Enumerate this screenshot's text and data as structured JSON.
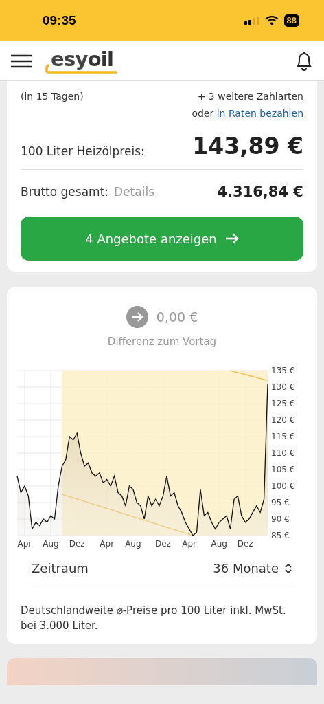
{
  "status_bar": {
    "time": "09:35",
    "battery": "88"
  },
  "header": {
    "logo": {
      "part1": "esy",
      "part2": "oil"
    }
  },
  "order_card": {
    "delivery_note": "(in 15 Tagen)",
    "payment_more": "+ 3 weitere Zahlarten",
    "installment_prefix": "oder",
    "installment_link": " in Raten bezahlen",
    "price_label": "100 Liter Heizölpreis:",
    "price": "143,89 €",
    "gross_label": "Brutto gesamt:",
    "gross_link": "Details",
    "gross": "4.316,84 €",
    "button": "4 Angebote anzeigen"
  },
  "chart_card": {
    "difference": "0,00 €",
    "difference_label": "Differenz zum Vortag",
    "chart_data": {
      "type": "area",
      "grid": true,
      "ylim": [
        85,
        135
      ],
      "categories": [
        null,
        null,
        "Apr",
        null,
        null,
        null,
        null,
        null,
        null,
        "Aug",
        null,
        null,
        null,
        null,
        null,
        null,
        "Dez",
        null,
        null,
        null,
        null,
        null,
        null,
        null,
        "Apr",
        null,
        null,
        null,
        null,
        null,
        null,
        "Aug",
        null,
        null,
        null,
        null,
        null,
        null,
        null,
        "Dez",
        null,
        null,
        null,
        null,
        null,
        null,
        "Apr",
        null,
        null,
        null,
        null,
        null,
        null,
        null,
        "Aug",
        null,
        null,
        null,
        null,
        null,
        null,
        "Dez",
        null,
        null,
        null,
        null,
        null,
        null
      ],
      "yticks": [
        {
          "value": 135,
          "label": "135 €"
        },
        {
          "value": 130,
          "label": "130 €"
        },
        {
          "value": 125,
          "label": "125 €"
        },
        {
          "value": 120,
          "label": "120 €"
        },
        {
          "value": 115,
          "label": "115 €"
        },
        {
          "value": 110,
          "label": "110 €"
        },
        {
          "value": 105,
          "label": "105 €"
        },
        {
          "value": 100,
          "label": "100 €"
        },
        {
          "value": 95,
          "label": "95 €"
        },
        {
          "value": 90,
          "label": "90 €"
        },
        {
          "value": 85,
          "label": "85 €"
        }
      ],
      "series": [
        {
          "color": "#111111",
          "values": [
            103,
            98,
            100,
            97,
            87,
            89,
            88,
            90,
            89,
            91,
            90,
            100,
            106,
            108,
            115,
            114,
            116,
            110,
            106,
            107,
            104,
            103,
            104,
            101,
            102,
            100,
            103,
            98,
            97,
            94,
            100,
            99,
            95,
            94,
            90,
            97,
            94,
            96,
            94,
            97,
            103,
            97,
            98,
            94,
            92,
            89,
            87,
            85,
            86,
            99,
            91,
            92,
            89,
            87,
            89,
            90,
            91,
            87,
            96,
            97,
            91,
            89,
            90,
            92,
            94,
            92,
            96,
            131
          ]
        },
        {
          "type": "line",
          "color": "#f3c15a",
          "values": [
            null,
            null,
            null,
            null,
            null,
            null,
            null,
            null,
            null,
            null,
            null,
            null,
            97.5,
            97.1,
            96.8,
            96.4,
            96.1,
            95.7,
            95.4,
            95.0,
            94.6,
            94.3,
            93.9,
            93.6,
            93.2,
            92.9,
            92.5,
            92.1,
            91.8,
            91.4,
            91.1,
            90.7,
            90.4,
            90.0,
            89.6,
            89.3,
            88.9,
            88.6,
            88.2,
            87.9,
            87.5,
            87.1,
            86.8,
            86.4,
            86.1,
            85.7,
            85.4,
            85.0,
            null,
            null,
            null,
            null,
            null,
            null,
            null,
            null,
            null,
            null,
            null,
            null,
            null,
            null,
            null,
            null,
            null,
            null,
            null,
            null
          ]
        },
        {
          "type": "line",
          "color": "#f3c15a",
          "values": [
            null,
            null,
            null,
            null,
            null,
            null,
            null,
            null,
            null,
            null,
            null,
            null,
            null,
            null,
            null,
            null,
            null,
            null,
            null,
            null,
            null,
            null,
            null,
            null,
            null,
            null,
            null,
            null,
            null,
            null,
            null,
            null,
            null,
            null,
            null,
            null,
            null,
            null,
            null,
            null,
            null,
            null,
            null,
            null,
            null,
            null,
            null,
            null,
            null,
            null,
            null,
            null,
            null,
            null,
            null,
            null,
            null,
            135,
            134.7,
            134.4,
            134.1,
            133.8,
            133.5,
            133.2,
            132.9,
            132.6,
            132.3,
            132
          ]
        }
      ]
    },
    "period_label": "Zeitraum",
    "period_value": "36 Monate",
    "footnote": "Deutschlandweite ⌀-Preise pro 100 Liter inkl. MwSt. bei 3.000 Liter."
  }
}
